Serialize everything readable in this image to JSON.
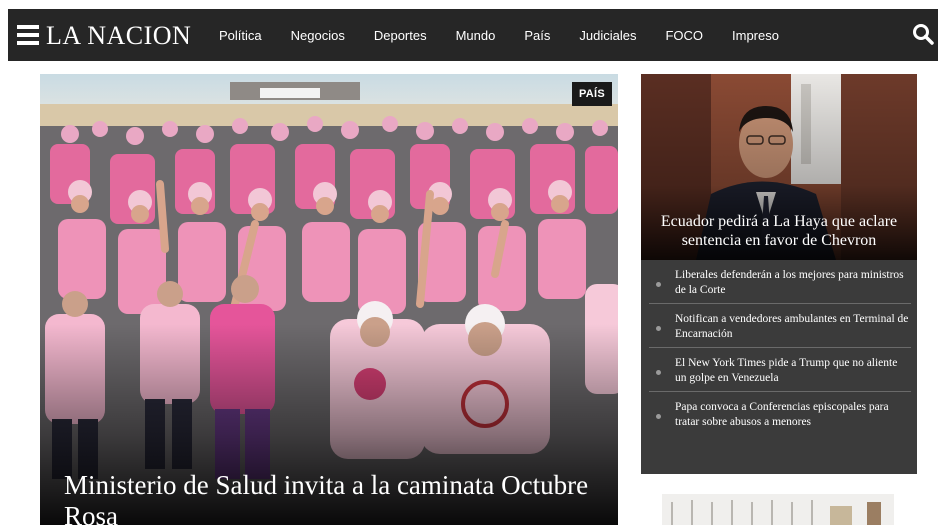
{
  "header": {
    "logo": "LA NACION",
    "nav": [
      "Política",
      "Negocios",
      "Deportes",
      "Mundo",
      "País",
      "Judiciales",
      "FOCO",
      "Impreso"
    ]
  },
  "hero": {
    "badge": "PAÍS",
    "title": "Ministerio de Salud invita a la caminata Octubre Rosa"
  },
  "sidebar": {
    "feature_title": "Ecuador pedirá a La Haya que aclare sentencia en favor de Chevron",
    "items": [
      "Liberales defenderán a los mejores para ministros de la Corte",
      "Notifican a vendedores ambulantes en Terminal de Encarnación",
      "El New York Times pide a Trump que no aliente un golpe en Venezuela",
      "Papa convoca a Conferencias episcopales para tratar sobre abusos a menores"
    ]
  },
  "colors": {
    "topbar": "#262626",
    "sidebar": "#3b3b3b",
    "hero_pink": "#e98fb3"
  }
}
